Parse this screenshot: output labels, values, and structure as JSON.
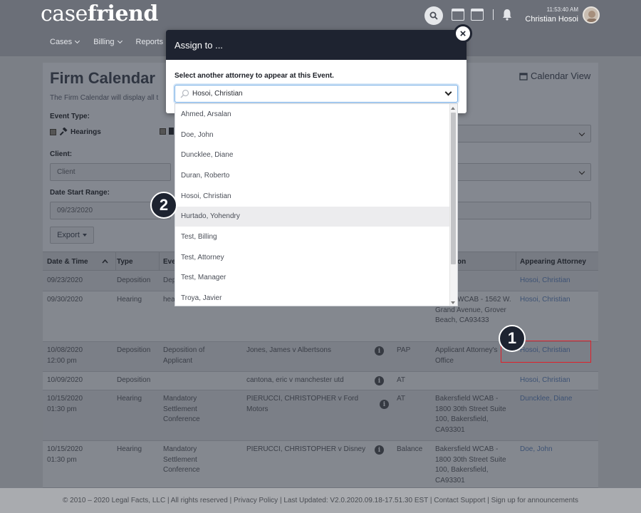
{
  "header": {
    "logo_part1": "case",
    "logo_part2": "friend",
    "nav": [
      "Cases",
      "Billing",
      "Reports"
    ],
    "time": "11:53:40 AM",
    "user": "Christian Hosoi"
  },
  "page": {
    "title": "Firm Calendar",
    "calendar_view": "Calendar View",
    "description": "The Firm Calendar will display all t",
    "event_type_label": "Event Type:",
    "hearings_label": "Hearings",
    "client_label": "Client:",
    "client_placeholder": "Client",
    "date_start_label": "Date Start Range:",
    "date_start_value": "09/23/2020",
    "export_label": "Export"
  },
  "table": {
    "headers": {
      "date": "Date & Time",
      "type": "Type",
      "event": "Eve",
      "location": "on",
      "attorney": "Appearing Attorney"
    },
    "rows": [
      {
        "date": "09/23/2020",
        "time": "",
        "type": "Deposition",
        "event": "Dep",
        "case": "",
        "venue": "",
        "location": "",
        "attorney": "Hosoi, Christian"
      },
      {
        "date": "09/30/2020",
        "time": "",
        "type": "Hearing",
        "event": "hea",
        "case": "",
        "venue": "",
        "location": "Beach WCAB - 1562 W. Grand Avenue, Grover Beach, CA93433",
        "attorney": "Hosoi, Christian"
      },
      {
        "date": "10/08/2020",
        "time": "12:00 pm",
        "type": "Deposition",
        "event": "Deposition of Applicant",
        "case": "Jones, James v Albertsons",
        "venue": "PAP",
        "location": "Applicant Attorney's Office",
        "attorney": "Hosoi, Christian"
      },
      {
        "date": "10/09/2020",
        "time": "",
        "type": "Deposition",
        "event": "",
        "case": "cantona, eric v manchester utd",
        "venue": "AT",
        "location": "",
        "attorney": "Hosoi, Christian"
      },
      {
        "date": "10/15/2020",
        "time": "01:30 pm",
        "type": "Hearing",
        "event": "Mandatory Settlement Conference",
        "case": "PIERUCCI, CHRISTOPHER v Ford Motors",
        "venue": "AT",
        "location": "Bakersfield WCAB - 1800 30th Street Suite 100, Bakersfield, CA93301",
        "attorney": "Duncklee, Diane"
      },
      {
        "date": "10/15/2020",
        "time": "01:30 pm",
        "type": "Hearing",
        "event": "Mandatory Settlement Conference",
        "case": "PIERUCCI, CHRISTOPHER v Disney",
        "venue": "Balance",
        "location": "Bakersfield WCAB - 1800 30th Street Suite 100, Bakersfield, CA93301",
        "attorney": "Doe, John"
      }
    ]
  },
  "modal": {
    "title": "Assign to ...",
    "close": "×",
    "label": "Select another attorney to appear at this Event.",
    "selected": "Hosoi, Christian",
    "options": [
      "Ahmed, Arsalan",
      "Doe, John",
      "Duncklee, Diane",
      "Duran, Roberto",
      "Hosoi, Christian",
      "Hurtado, Yohendry",
      "Test, Billing",
      "Test, Attorney",
      "Test, Manager",
      "Troya, Javier"
    ],
    "highlighted_index": 5
  },
  "annotations": {
    "badge1": "1",
    "badge2": "2"
  },
  "footer": {
    "text": "© 2010 – 2020 Legal Facts, LLC | All rights reserved | Privacy Policy | Last Updated: V2.0.2020.09.18-17.51.30 EST | Contact Support | Sign up for announcements"
  },
  "icons": [
    "search-icon",
    "calendar-icon",
    "bell-icon",
    "gavel-icon",
    "info-icon",
    "close-icon",
    "chevron-down-icon"
  ],
  "colors": {
    "overlay_header": "#1e2330",
    "highlight_box": "#e0202a",
    "link": "#3d5274"
  }
}
